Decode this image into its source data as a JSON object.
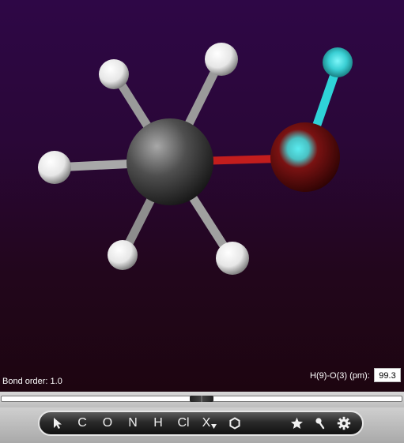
{
  "status": {
    "bond_order": "Bond order: 1.0",
    "measurement_label": "H(9)-O(3) (pm):",
    "measurement_value": "99.3"
  },
  "slider": {
    "level": 0.5
  },
  "toolbar": {
    "select_icon": "cursor-arrow-icon",
    "elements": [
      "C",
      "O",
      "N",
      "H",
      "Cl",
      "X"
    ],
    "ring_icon": "hexagon-icon",
    "right_icons": [
      "star-icon",
      "wand-icon",
      "gear-icon"
    ]
  },
  "colors": {
    "background_top": "#2e0746",
    "background_bottom": "#1d0510",
    "carbon": "#555555",
    "hydrogen": "#ffffff",
    "oxygen": "#8b0a0a",
    "highlight": "#2fd3d8",
    "bond_co": "#c21d1d"
  }
}
